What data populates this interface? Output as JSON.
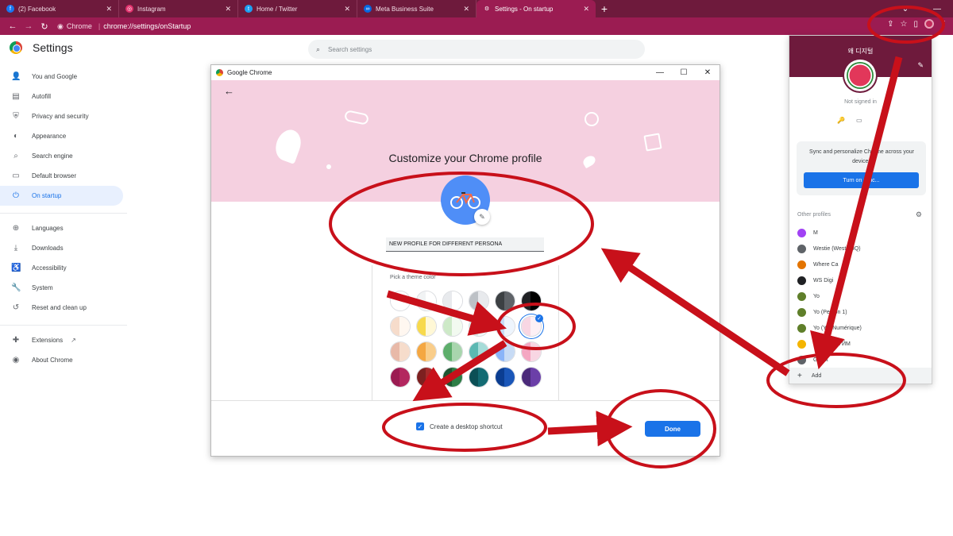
{
  "tabs": [
    {
      "label": "(2) Facebook",
      "fav_color": "#1877f2",
      "fav_glyph": "f"
    },
    {
      "label": "Instagram",
      "fav_color": "#e1306c",
      "fav_glyph": "◎"
    },
    {
      "label": "Home / Twitter",
      "fav_color": "#1da1f2",
      "fav_glyph": "t"
    },
    {
      "label": "Meta Business Suite",
      "fav_color": "#0668e1",
      "fav_glyph": "∞"
    },
    {
      "label": "Settings - On startup",
      "fav_color": "#9b1c52",
      "fav_glyph": "⚙"
    }
  ],
  "omnibox": {
    "site": "Chrome",
    "url": "chrome://settings/onStartup"
  },
  "settings": {
    "title": "Settings",
    "search_placeholder": "Search settings",
    "nav": [
      {
        "label": "You and Google",
        "icon": "person-icon",
        "glyph": "👤"
      },
      {
        "label": "Autofill",
        "icon": "clipboard-icon",
        "glyph": "▤"
      },
      {
        "label": "Privacy and security",
        "icon": "shield-icon",
        "glyph": "⛨"
      },
      {
        "label": "Appearance",
        "icon": "palette-icon",
        "glyph": "◐"
      },
      {
        "label": "Search engine",
        "icon": "search-icon",
        "glyph": "⌕"
      },
      {
        "label": "Default browser",
        "icon": "browser-icon",
        "glyph": "▭"
      },
      {
        "label": "On startup",
        "icon": "power-icon",
        "glyph": "⏻"
      }
    ],
    "nav2": [
      {
        "label": "Languages",
        "icon": "globe-icon",
        "glyph": "⊕"
      },
      {
        "label": "Downloads",
        "icon": "download-icon",
        "glyph": "⤓"
      },
      {
        "label": "Accessibility",
        "icon": "accessibility-icon",
        "glyph": "♿"
      },
      {
        "label": "System",
        "icon": "wrench-icon",
        "glyph": "🔧"
      },
      {
        "label": "Reset and clean up",
        "icon": "history-icon",
        "glyph": "↺"
      }
    ],
    "nav3": [
      {
        "label": "Extensions",
        "icon": "puzzle-icon",
        "glyph": "✚",
        "suffix": "↗"
      },
      {
        "label": "About Chrome",
        "icon": "chrome-icon",
        "glyph": "◉"
      }
    ]
  },
  "dialog": {
    "window_title": "Google Chrome",
    "heading": "Customize your Chrome profile",
    "profile_name": "NEW PROFILE FOR DIFFERENT PERSONA",
    "theme_label": "Pick a theme color",
    "shortcut_label": "Create a desktop shortcut",
    "done_label": "Done",
    "swatches": [
      [
        "#ffffff",
        "#ffffff"
      ],
      [
        "#f1f3f4",
        "#ffffff"
      ],
      [
        "#e8eaed",
        "#ffffff"
      ],
      [
        "#bdc1c6",
        "#e8eaed"
      ],
      [
        "#3c4043",
        "#5f6368"
      ],
      [
        "#202124",
        "#000000"
      ],
      [
        "#f6dccb",
        "#fff7f0"
      ],
      [
        "#f7d94c",
        "#fff8d6"
      ],
      [
        "#cde9c7",
        "#f2faf0"
      ],
      [
        "#d6ede9",
        "#f0faf8"
      ],
      [
        "#c7dbf5",
        "#eef5fd"
      ],
      [
        "#f8d6e3",
        "#fdf0f5"
      ],
      [
        "#e8b9a8",
        "#f6dccb"
      ],
      [
        "#f4a742",
        "#f9cd8a"
      ],
      [
        "#5dae6b",
        "#a8d5ad"
      ],
      [
        "#5cb8b2",
        "#a6dcd8"
      ],
      [
        "#8ab4f8",
        "#c7dbf5"
      ],
      [
        "#f4a7c2",
        "#f8d6e3"
      ],
      [
        "#9b1c52",
        "#b3275f"
      ],
      [
        "#7d2020",
        "#a52a2a"
      ],
      [
        "#1e5631",
        "#2e7d46"
      ],
      [
        "#0b4f55",
        "#136b73"
      ],
      [
        "#0b3d91",
        "#1a56b8"
      ],
      [
        "#4b2a7a",
        "#6b3fa8"
      ]
    ]
  },
  "profile_menu": {
    "name": "왜 디지털",
    "status": "Not signed in",
    "sync_text": "Sync and personalize Chrome across your devices",
    "turn_on_label": "Turn on sync...",
    "other_profiles_label": "Other profiles",
    "profiles": [
      {
        "label": "M",
        "color": "#a142f4"
      },
      {
        "label": "Westie (WestieHQ)",
        "color": "#5f6368"
      },
      {
        "label": "Where Ca",
        "color": "#e37400"
      },
      {
        "label": "WS Digi",
        "color": "#202124"
      },
      {
        "label": "Yo",
        "color": "#5f7f2a"
      },
      {
        "label": "Yo (Person 1)",
        "color": "#5f7f2a"
      },
      {
        "label": "Yo (YO Numérique)",
        "color": "#5f7f2a"
      },
      {
        "label": "Цифровой ЙМ",
        "color": "#f4b400"
      },
      {
        "label": "Guest",
        "color": "#5f6368"
      }
    ],
    "add_label": "Add"
  },
  "annotation_color": "#c8101a"
}
